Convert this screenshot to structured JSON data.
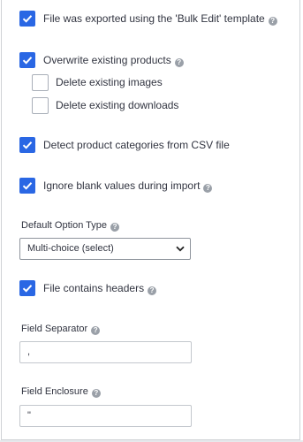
{
  "options": {
    "bulk_edit": {
      "label": "File was exported using the 'Bulk Edit' template",
      "checked": true
    },
    "overwrite": {
      "label": "Overwrite existing products",
      "checked": true
    },
    "delete_images": {
      "label": "Delete existing images",
      "checked": false
    },
    "delete_downloads": {
      "label": "Delete existing downloads",
      "checked": false
    },
    "detect_categories": {
      "label": "Detect product categories from CSV file",
      "checked": true
    },
    "ignore_blank": {
      "label": "Ignore blank values during import",
      "checked": true
    },
    "headers": {
      "label": "File contains headers",
      "checked": true
    }
  },
  "default_option_type": {
    "label": "Default Option Type",
    "selected": "Multi-choice (select)"
  },
  "field_separator": {
    "label": "Field Separator",
    "value": ","
  },
  "field_enclosure": {
    "label": "Field Enclosure",
    "value": "\""
  },
  "help_icon_glyph": "?",
  "colors": {
    "accent": "#2a67e4",
    "help": "#9aa0a8",
    "text": "#313440"
  }
}
